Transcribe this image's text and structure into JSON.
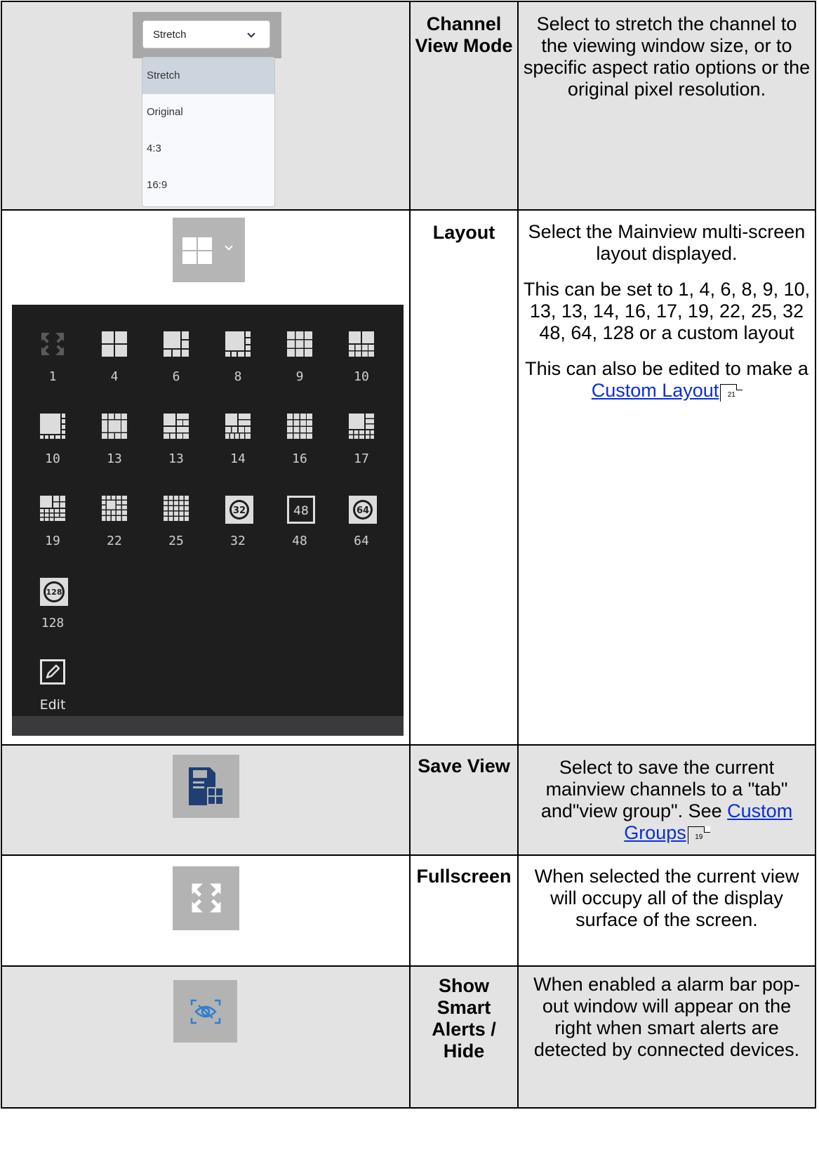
{
  "rows": [
    {
      "name": "Channel View Mode",
      "description": "Select to stretch the channel to the viewing window size, or to specific aspect ratio options or the original pixel resolution.",
      "dropdown": {
        "selected": "Stretch",
        "options": [
          "Stretch",
          "Original",
          "4:3",
          "16:9"
        ]
      }
    },
    {
      "name": "Layout",
      "description_1": "Select the Mainview multi-screen layout displayed.",
      "description_2": "This can be set to 1, 4, 6, 8, 9, 10, 13, 13, 14, 16, 17, 19, 22, 25, 32 48, 64, 128 or a custom layout",
      "description_3_prefix": "This can also be edited to make a ",
      "link": "Custom Layout",
      "page_ref": "21",
      "layouts": [
        "1",
        "4",
        "6",
        "8",
        "9",
        "10",
        "10",
        "13",
        "13",
        "14",
        "16",
        "17",
        "19",
        "22",
        "25",
        "32",
        "48",
        "64",
        "128"
      ],
      "edit_label": "Edit"
    },
    {
      "name": "Save View",
      "description_prefix": "Select to save the current mainview channels to a \"tab\" and\"view group\". See ",
      "link": "Custom Groups",
      "page_ref": "19"
    },
    {
      "name": "Fullscreen",
      "description": "When selected the current view will occupy all of the display surface of the screen."
    },
    {
      "name": "Show Smart Alerts / Hide",
      "description": "When enabled a alarm bar pop-out window will appear on the right when smart alerts are detected by connected devices."
    }
  ],
  "colors": {
    "link": "#0a2fd6",
    "panel": "#1e1e1f",
    "save_icon": "#1f3f74",
    "alert_icon": "#2f7fd0"
  },
  "icons": [
    "chevron-down-icon",
    "grid-layout-icon",
    "expand-icon",
    "edit-icon",
    "save-view-icon",
    "fullscreen-icon",
    "smart-alert-eye-icon"
  ]
}
